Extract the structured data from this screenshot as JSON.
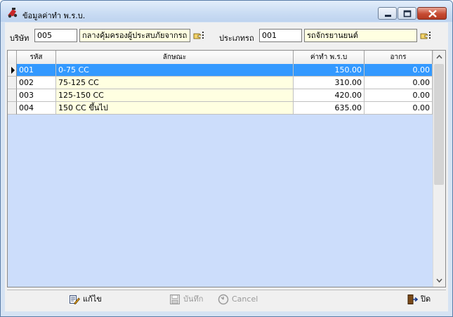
{
  "window": {
    "title": "ข้อมูลค่าทำ พ.ร.บ."
  },
  "filters": {
    "company_label": "บริษัท",
    "company_code": "005",
    "company_name": "กลางคุ้มครองผู้ประสบภัยจากรถ จ",
    "vehicle_type_label": "ประเภทรถ",
    "vehicle_type_code": "001",
    "vehicle_type_name": "รถจักรยานยนต์"
  },
  "table": {
    "columns": [
      "รหัส",
      "ลักษณะ",
      "ค่าทำ พ.ร.บ",
      "อากร"
    ],
    "rows": [
      {
        "code": "001",
        "desc": "0-75 CC",
        "fee": "150.00",
        "duty": "0.00",
        "selected": true
      },
      {
        "code": "002",
        "desc": "75-125 CC",
        "fee": "310.00",
        "duty": "0.00",
        "selected": false
      },
      {
        "code": "003",
        "desc": "125-150 CC",
        "fee": "420.00",
        "duty": "0.00",
        "selected": false
      },
      {
        "code": "004",
        "desc": "150 CC ขึ้นไป",
        "fee": "635.00",
        "duty": "0.00",
        "selected": false
      }
    ]
  },
  "toolbar": {
    "edit_label": "แก้ไข",
    "save_label": "บันทึก",
    "cancel_label": "Cancel",
    "close_label": "ปิด"
  },
  "colors": {
    "selection": "#3399ff",
    "grid_bg": "#ccddfb",
    "cell_yellow": "#ffffe1"
  }
}
